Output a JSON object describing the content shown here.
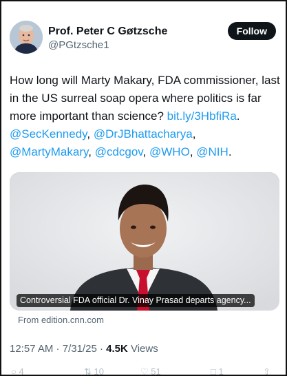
{
  "author": {
    "name": "Prof. Peter C Gøtzsche",
    "handle": "@PGtzsche1"
  },
  "follow_label": "Follow",
  "tweet": {
    "text": "How long will Marty Makary, FDA commissioner, last in the US surreal soap opera where politics is far more important than science? ",
    "link": "bit.ly/3HbfiRa",
    "period": ".",
    "mentions": [
      "@SecKennedy",
      "@DrJBhattacharya",
      "@MartyMakary",
      "@cdcgov",
      "@WHO",
      "@NIH"
    ]
  },
  "card": {
    "caption": "Controversial FDA official Dr. Vinay Prasad departs agency...",
    "source": "From edition.cnn.com"
  },
  "meta": {
    "time": "12:57 AM",
    "date": "7/31/25",
    "views_count": "4.5K",
    "views_label": "Views"
  },
  "actions": {
    "reply_count": "4",
    "retweet_count": "10",
    "like_count": "51",
    "bookmark_count": "1"
  },
  "colors": {
    "link": "#1d9bf0",
    "follow_bg": "#0f1419",
    "muted": "#536471"
  }
}
